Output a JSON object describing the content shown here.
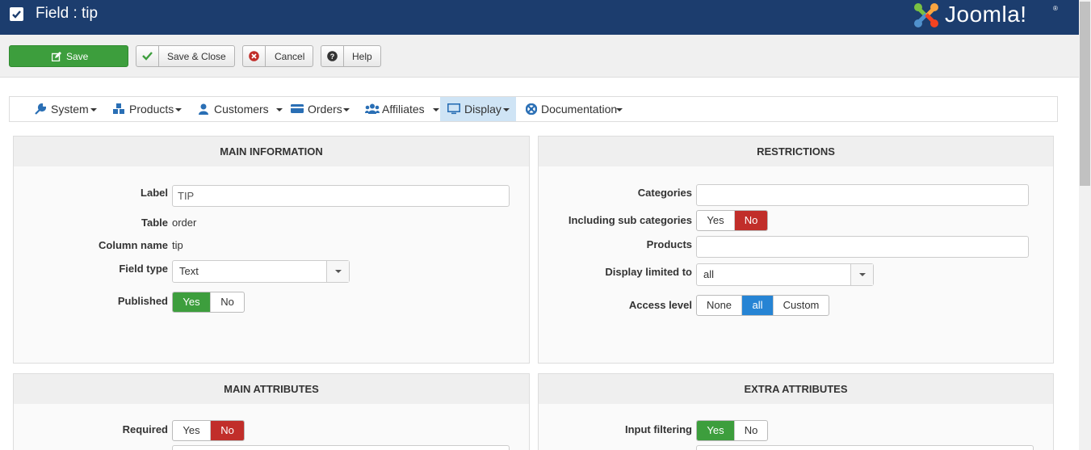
{
  "header": {
    "title": "Field : tip",
    "logo_text": "Joomla!",
    "logo_reg": "®"
  },
  "toolbar": {
    "save_label": "Save",
    "save_close_label": "Save & Close",
    "cancel_label": "Cancel",
    "help_label": "Help"
  },
  "menu": {
    "items": [
      {
        "label": "System",
        "icon": "wrench-icon"
      },
      {
        "label": "Products",
        "icon": "cubes-icon"
      },
      {
        "label": "Customers",
        "icon": "user-icon"
      },
      {
        "label": "Orders",
        "icon": "credit-card-icon"
      },
      {
        "label": "Affiliates",
        "icon": "users-icon"
      },
      {
        "label": "Display",
        "icon": "monitor-icon",
        "active": true
      },
      {
        "label": "Documentation",
        "icon": "life-ring-icon"
      }
    ]
  },
  "main_info": {
    "heading": "MAIN INFORMATION",
    "label_label": "Label",
    "label_value": "TIP",
    "table_label": "Table",
    "table_value": "order",
    "column_label": "Column name",
    "column_value": "tip",
    "fieldtype_label": "Field type",
    "fieldtype_value": "Text",
    "published_label": "Published",
    "published_yes": "Yes",
    "published_no": "No",
    "published_selected": "Yes"
  },
  "restrictions": {
    "heading": "RESTRICTIONS",
    "categories_label": "Categories",
    "categories_value": "",
    "subcat_label": "Including sub categories",
    "subcat_yes": "Yes",
    "subcat_no": "No",
    "subcat_selected": "No",
    "products_label": "Products",
    "products_value": "",
    "display_limited_label": "Display limited to",
    "display_limited_value": "all",
    "access_label": "Access level",
    "access_none": "None",
    "access_all": "all",
    "access_custom": "Custom",
    "access_selected": "all"
  },
  "main_attributes": {
    "heading": "MAIN ATTRIBUTES",
    "required_label": "Required",
    "required_yes": "Yes",
    "required_no": "No",
    "required_selected": "No"
  },
  "extra_attributes": {
    "heading": "EXTRA ATTRIBUTES",
    "filtering_label": "Input filtering",
    "filtering_yes": "Yes",
    "filtering_no": "No",
    "filtering_selected": "Yes"
  },
  "colors": {
    "header_bg": "#1c3d6e",
    "green": "#3d9e3d",
    "red": "#c12e2a",
    "blue": "#2684d4",
    "menu_active": "#cfe4f5"
  }
}
